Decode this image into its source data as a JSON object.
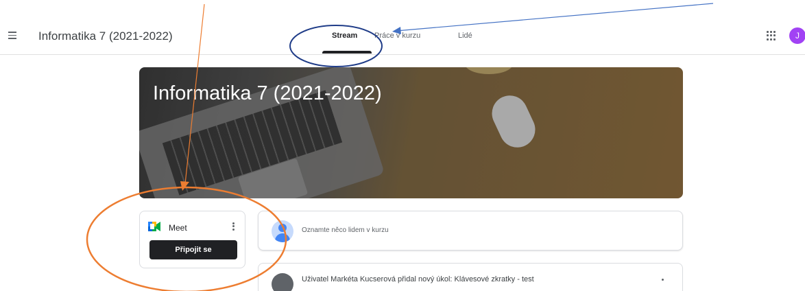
{
  "header": {
    "class_title": "Informatika 7 (2021-2022)",
    "avatar_letter": "J",
    "tabs": [
      {
        "label": "Stream",
        "active": true
      },
      {
        "label": "Práce v kurzu",
        "active": false
      },
      {
        "label": "Lidé",
        "active": false
      }
    ]
  },
  "banner": {
    "title": "Informatika 7 (2021-2022)"
  },
  "meet": {
    "label": "Meet",
    "join_label": "Připojit se"
  },
  "stream": {
    "announce_placeholder": "Oznamte něco lidem v kurzu",
    "post_text": "Uživatel Markéta Kucserová přidal nový úkol: Klávesové zkratky - test"
  },
  "annotations": {
    "arrow_color": "#4472c4",
    "ellipse_blue": "#1f3c88",
    "arrow_orange": "#ed7d31",
    "ellipse_orange": "#ed7d31"
  },
  "colors": {
    "avatar": "#a142f4",
    "join_button": "#202124"
  }
}
